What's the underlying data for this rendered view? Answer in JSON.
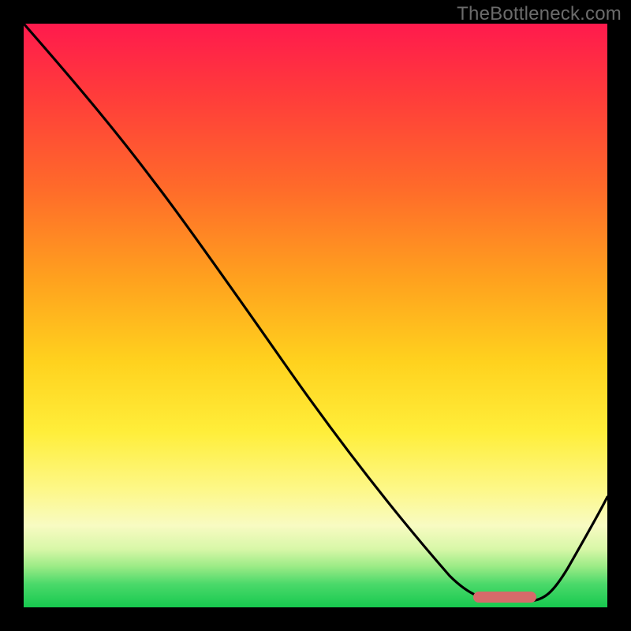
{
  "watermark": "TheBottleneck.com",
  "chart_data": {
    "type": "line",
    "title": "",
    "xlabel": "",
    "ylabel": "",
    "xlim": [
      0,
      1
    ],
    "ylim": [
      0,
      1
    ],
    "series": [
      {
        "name": "curve",
        "x": [
          0.0,
          0.1,
          0.2,
          0.3,
          0.4,
          0.5,
          0.6,
          0.7,
          0.78,
          0.84,
          0.9,
          1.0
        ],
        "values": [
          1.0,
          0.88,
          0.78,
          0.65,
          0.52,
          0.4,
          0.27,
          0.14,
          0.04,
          0.01,
          0.04,
          0.18
        ]
      }
    ],
    "marker": {
      "x_start": 0.78,
      "x_end": 0.88,
      "y": 0.015,
      "color": "#d66a6a"
    },
    "background_gradient": [
      "#ff1a4d",
      "#ffa21e",
      "#ffee3a",
      "#17c94f"
    ]
  }
}
